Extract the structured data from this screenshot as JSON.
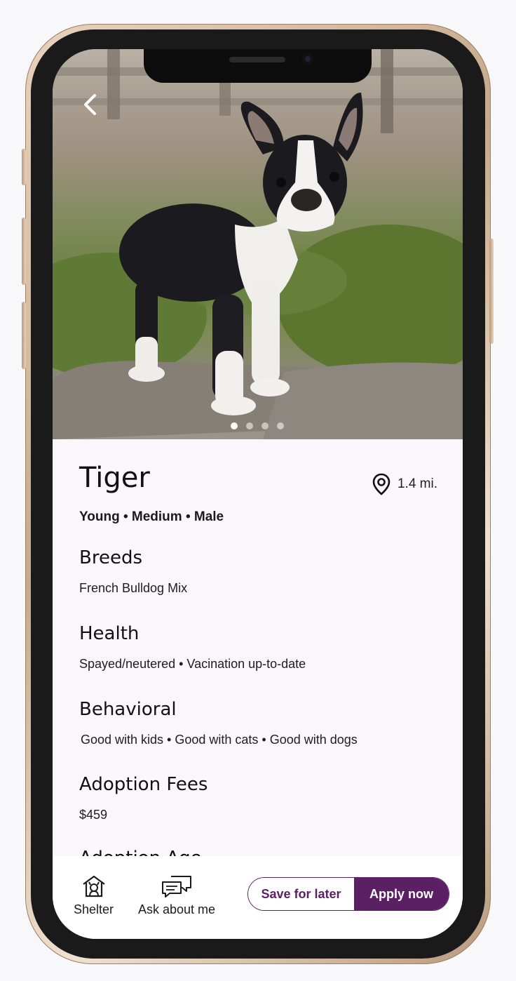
{
  "pet": {
    "name": "Tiger",
    "distance": "1.4 mi.",
    "attributes": "Young • Medium • Male"
  },
  "sections": {
    "breeds": {
      "title": "Breeds",
      "body": "French Bulldog Mix"
    },
    "health": {
      "title": "Health",
      "body": "Spayed/neutered • Vacination up-to-date"
    },
    "behavioral": {
      "title": "Behavioral",
      "body": "Good with kids • Good with cats • Good with dogs"
    },
    "fees": {
      "title": "Adoption Fees",
      "body": "$459"
    },
    "next": {
      "title": "Adoption Age"
    }
  },
  "gallery": {
    "dots": 4,
    "active_index": 0
  },
  "bottom_bar": {
    "shelter_label": "Shelter",
    "ask_label": "Ask about me",
    "save_label": "Save for later",
    "apply_label": "Apply now"
  },
  "colors": {
    "accent": "#5b1f63"
  },
  "icons": [
    "back-chevron-icon",
    "map-pin-icon",
    "shelter-house-icon",
    "chat-bubbles-icon"
  ]
}
